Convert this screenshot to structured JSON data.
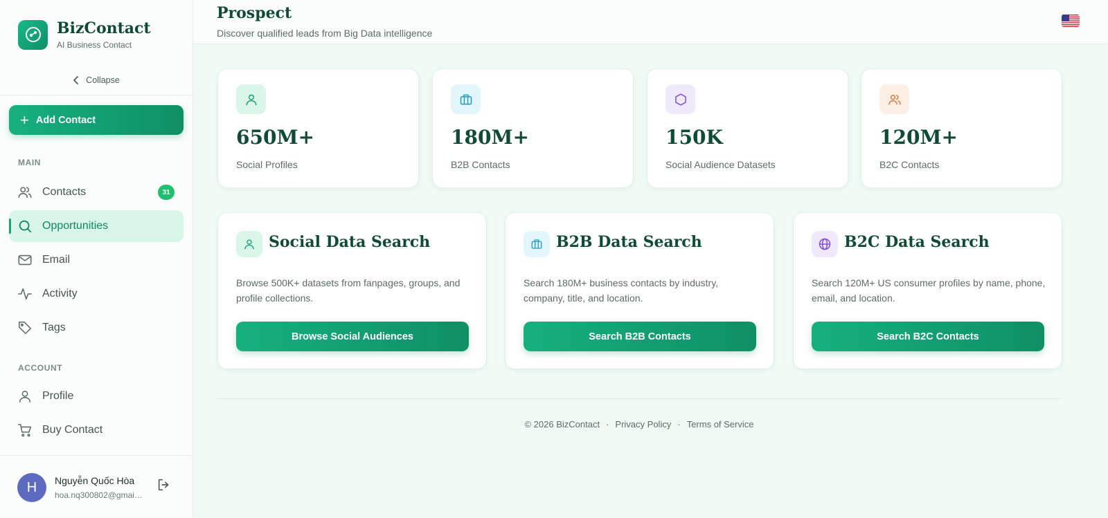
{
  "app": {
    "name": "BizContact",
    "tagline": "AI Business Contact",
    "collapse_label": "Collapse",
    "add_contact_label": "Add Contact"
  },
  "sidebar": {
    "main_section": "MAIN",
    "account_section": "ACCOUNT",
    "items": [
      {
        "label": "Contacts",
        "icon": "users-icon",
        "badge": "31"
      },
      {
        "label": "Opportunities",
        "icon": "search-icon",
        "active": true
      },
      {
        "label": "Email",
        "icon": "mail-icon"
      },
      {
        "label": "Activity",
        "icon": "activity-icon"
      },
      {
        "label": "Tags",
        "icon": "tag-icon"
      }
    ],
    "account_items": [
      {
        "label": "Profile",
        "icon": "user-icon"
      },
      {
        "label": "Buy Contact",
        "icon": "cart-icon"
      }
    ]
  },
  "user": {
    "initial": "H",
    "name": "Nguyễn Quốc Hòa",
    "email": "hoa.nq300802@gmail.com"
  },
  "header": {
    "title": "Prospect",
    "subtitle": "Discover qualified leads from Big Data intelligence",
    "language_icon": "us-flag-icon"
  },
  "stats": [
    {
      "value": "650M+",
      "label": "Social Profiles",
      "icon": "user-icon",
      "color": "#16a36f",
      "bg": "#d9f6e9"
    },
    {
      "value": "180M+",
      "label": "B2B Contacts",
      "icon": "briefcase-icon",
      "color": "#1e9bc7",
      "bg": "#e2f6fb"
    },
    {
      "value": "150K",
      "label": "Social Audience Datasets",
      "icon": "hexagon-icon",
      "color": "#7c4dda",
      "bg": "#efe9fb"
    },
    {
      "value": "120M+",
      "label": "B2C Contacts",
      "icon": "users-icon",
      "color": "#e07a3a",
      "bg": "#fdefe4"
    }
  ],
  "search_cards": [
    {
      "title": "Social Data Search",
      "description": "Browse 500K+ datasets from fanpages, groups, and profile collections.",
      "button": "Browse Social Audiences",
      "icon": "user-icon",
      "color": "#16a36f",
      "bg": "#d9f6e9"
    },
    {
      "title": "B2B Data Search",
      "description": "Search 180M+ business contacts by industry, company, title, and location.",
      "button": "Search B2B Contacts",
      "icon": "briefcase-icon",
      "color": "#1e9bc7",
      "bg": "#e2f6fb"
    },
    {
      "title": "B2C Data Search",
      "description": "Search 120M+ US consumer profiles by name, phone, email, and location.",
      "button": "Search B2C Contacts",
      "icon": "globe-icon",
      "color": "#7c4dda",
      "bg": "#efe9fb"
    }
  ],
  "footer": {
    "copyright": "© 2026 BizContact",
    "separator": "·",
    "privacy": "Privacy Policy",
    "terms": "Terms of Service"
  }
}
